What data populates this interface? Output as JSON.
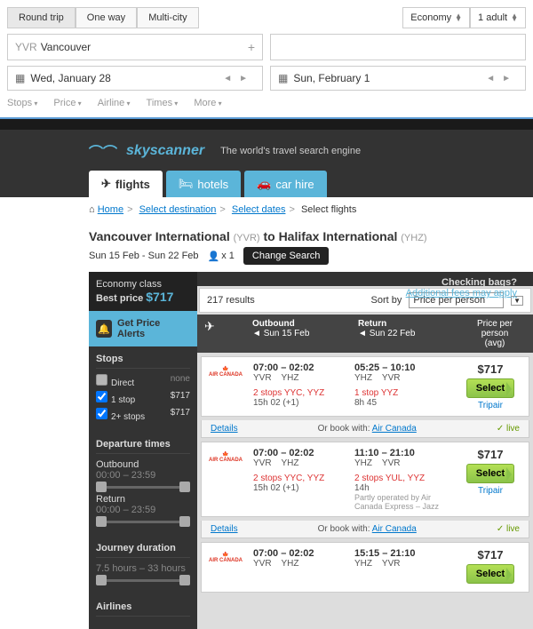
{
  "topsearch": {
    "trip_tabs": [
      "Round trip",
      "One way",
      "Multi-city"
    ],
    "class": "Economy",
    "pax": "1 adult",
    "origin_code": "YVR",
    "origin_city": "Vancouver",
    "dest": "",
    "depart": "Wed, January 28",
    "return": "Sun, February 1",
    "filters": [
      "Stops",
      "Price",
      "Airline",
      "Times",
      "More"
    ]
  },
  "brand": {
    "name": "skyscanner",
    "tagline": "The world's travel search engine"
  },
  "nav": {
    "flights": "flights",
    "hotels": "hotels",
    "car": "car hire"
  },
  "breadcrumb": {
    "home": "Home",
    "dest": "Select destination",
    "dates": "Select dates",
    "current": "Select flights"
  },
  "route": {
    "from": "Vancouver International",
    "from_code": "(YVR)",
    "to_word": "to",
    "to": "Halifax International",
    "to_code": "(YHZ)",
    "dates": "Sun 15 Feb - Sun 22 Feb",
    "pax": "1",
    "change": "Change Search"
  },
  "social_count": "0",
  "sidebar": {
    "class": "Economy class",
    "best_label": "Best price",
    "best_price": "$717",
    "alert": "Get Price Alerts",
    "stops": {
      "title": "Stops",
      "direct": "Direct",
      "direct_v": "none",
      "s1": "1 stop",
      "s1_v": "$717",
      "s2": "2+ stops",
      "s2_v": "$717"
    },
    "dep": {
      "title": "Departure times",
      "out": "Outbound",
      "out_r": "00:00 – 23:59",
      "ret": "Return",
      "ret_r": "00:00 – 23:59"
    },
    "dur": {
      "title": "Journey duration",
      "range": "7.5 hours – 33 hours"
    },
    "airlines": "Airlines"
  },
  "results": {
    "count": "217 results",
    "bags": "Checking bags?",
    "fees": "Additional fees may apply",
    "sort_label": "Sort by",
    "sort_value": "Price per person",
    "cols": {
      "out": "Outbound",
      "out_d": "Sun 15 Feb",
      "ret": "Return",
      "ret_d": "Sun 22 Feb",
      "price": "Price per person\n(avg)"
    },
    "book_with": "Or book with:",
    "details": "Details",
    "live": "live",
    "rows": [
      {
        "airline": "AIR CANADA",
        "o_times": "07:00 – 02:02",
        "o_codes": "YVR    YHZ",
        "o_stops": "2 stops YYC, YYZ",
        "o_dur": "15h 02 (+1)",
        "r_times": "05:25 – 10:10",
        "r_codes": "YHZ    YVR",
        "r_stops": "1 stop YYZ",
        "r_dur": "8h 45",
        "price": "$717",
        "select": "Select",
        "agent": "Tripair",
        "book": "Air Canada"
      },
      {
        "airline": "AIR CANADA",
        "o_times": "07:00 – 02:02",
        "o_codes": "YVR    YHZ",
        "o_stops": "2 stops YYC, YYZ",
        "o_dur": "15h 02 (+1)",
        "r_times": "11:10 – 21:10",
        "r_codes": "YHZ    YVR",
        "r_stops": "2 stops YUL, YYZ",
        "r_dur": "14h",
        "r_oper": "Partly operated by Air Canada Express – Jazz",
        "price": "$717",
        "select": "Select",
        "agent": "Tripair",
        "book": "Air Canada"
      },
      {
        "airline": "AIR CANADA",
        "o_times": "07:00 – 02:02",
        "o_codes": "YVR    YHZ",
        "r_times": "15:15 – 21:10",
        "r_codes": "YHZ    YVR",
        "price": "$717",
        "select": "Select"
      }
    ]
  }
}
